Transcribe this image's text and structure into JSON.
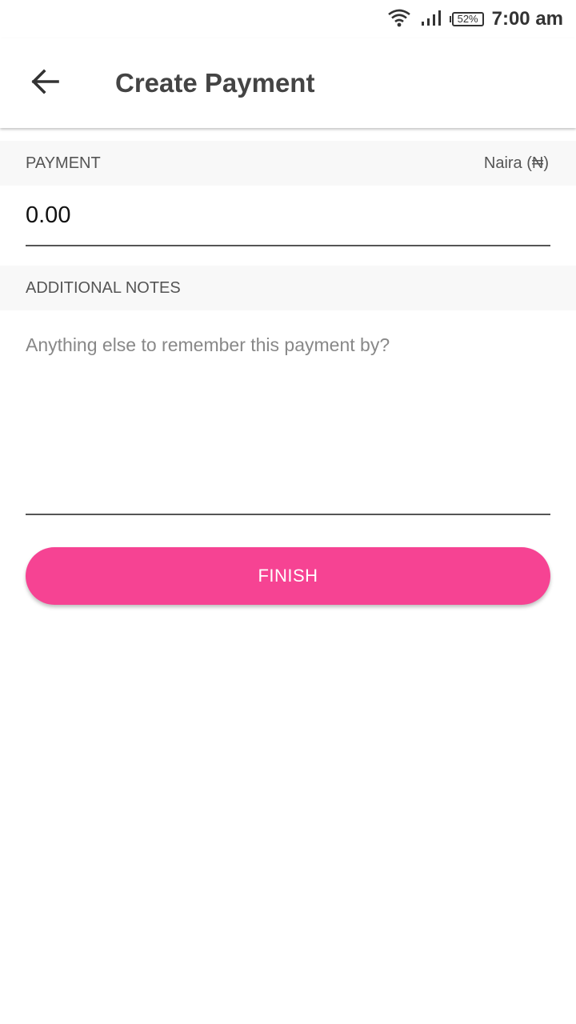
{
  "status_bar": {
    "battery_percent": "52%",
    "time": "7:00 am",
    "icons": [
      "wifi-icon",
      "signal-icon",
      "battery-icon"
    ]
  },
  "app_bar": {
    "back_icon": "arrow-left-icon",
    "title": "Create Payment"
  },
  "payment_section": {
    "label": "PAYMENT",
    "currency": "Naira (₦)",
    "amount_value": "0.00"
  },
  "notes_section": {
    "label": "ADDITIONAL NOTES",
    "placeholder": "Anything else to remember this payment by?"
  },
  "finish_button": {
    "label": "FINISH"
  },
  "colors": {
    "accent": "#f64393",
    "section_background": "#f8f8f8",
    "title_text": "#444444"
  }
}
